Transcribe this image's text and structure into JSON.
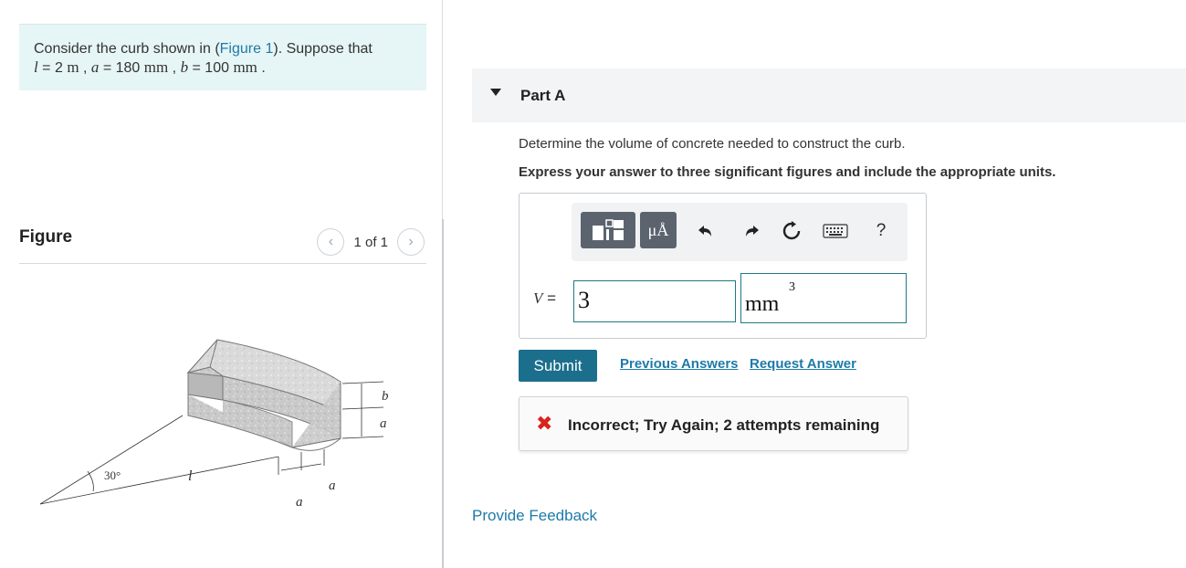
{
  "problem": {
    "intro": "Consider the curb shown in (",
    "figure_link": "Figure 1",
    "intro_end": "). Suppose that",
    "l_var": "l",
    "l_eq": " = 2 ",
    "l_unit": "m",
    "sep1": " , ",
    "a_var": "a",
    "a_eq": " = 180 ",
    "a_unit": "mm",
    "sep2": " , ",
    "b_var": "b",
    "b_eq": " = 100 ",
    "b_unit": "mm",
    "end": " ."
  },
  "figure": {
    "title": "Figure",
    "pager_text": "1 of 1",
    "labels": {
      "angle": "30°",
      "l": "l",
      "a_bottom": "a",
      "a_mid": "a",
      "a_right": "a",
      "b_right": "b"
    }
  },
  "part": {
    "title": "Part A",
    "question": "Determine the volume of concrete needed to construct the curb.",
    "instruction": "Express your answer to three significant figures and include the appropriate units."
  },
  "toolbar": {
    "units_button": "μÅ",
    "icons": [
      "templates-icon",
      "units-icon",
      "undo-icon",
      "redo-icon",
      "reset-icon",
      "keyboard-icon",
      "help-icon"
    ],
    "help": "?"
  },
  "answer": {
    "var": "V",
    "eq": " = ",
    "value": "3",
    "unit_base": "mm",
    "unit_exp": "3"
  },
  "actions": {
    "submit": "Submit",
    "previous": "Previous Answers",
    "request": "Request Answer"
  },
  "feedback": {
    "mark": "✖",
    "text": "Incorrect; Try Again; 2 attempts remaining"
  },
  "footer": {
    "provide_feedback": "Provide Feedback"
  },
  "colors": {
    "accent": "#1b6f8d",
    "link": "#1e7aa8",
    "problem_bg": "#e6f5f5",
    "error": "#d9231b",
    "input_border": "#1d7a84"
  }
}
